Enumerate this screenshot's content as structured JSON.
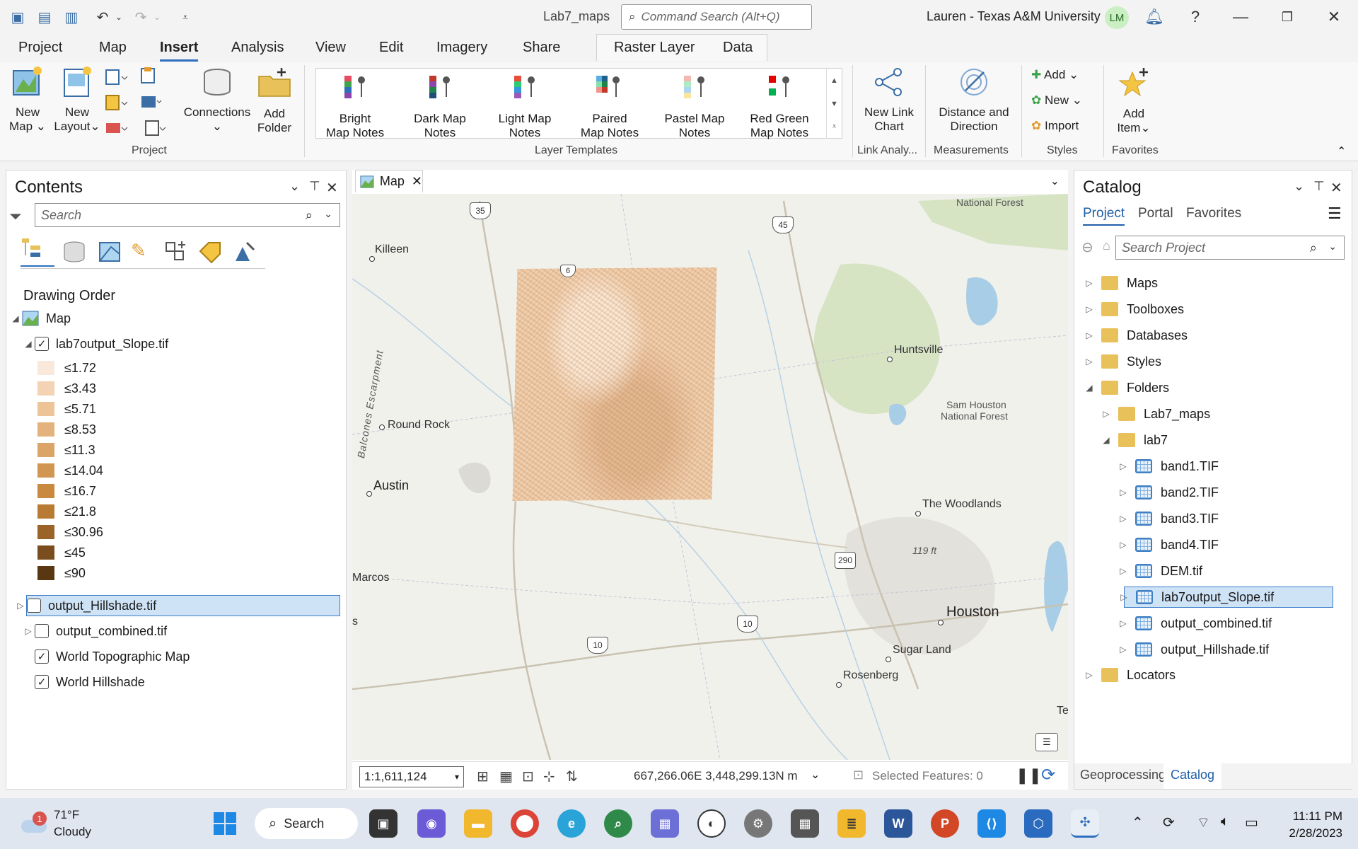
{
  "titlebar": {
    "app_title": "Lab7_maps",
    "command_search_placeholder": "Command Search (Alt+Q)",
    "user": "Lauren - Texas A&M University",
    "avatar_initials": "LM"
  },
  "ribbon_tabs": [
    "Project",
    "Map",
    "Insert",
    "Analysis",
    "View",
    "Edit",
    "Imagery",
    "Share"
  ],
  "active_tab": "Insert",
  "contextual_tabs": [
    "Raster Layer",
    "Data"
  ],
  "ribbon": {
    "project_group": {
      "label": "Project",
      "new_map": [
        "New",
        "Map"
      ],
      "new_layout": [
        "New",
        "Layout"
      ],
      "connections": "Connections",
      "add_folder": [
        "Add",
        "Folder"
      ]
    },
    "layer_templates": {
      "label": "Layer Templates",
      "items": [
        {
          "line1": "Bright",
          "line2": "Map Notes"
        },
        {
          "line1": "Dark Map",
          "line2": "Notes"
        },
        {
          "line1": "Light Map",
          "line2": "Notes"
        },
        {
          "line1": "Paired",
          "line2": "Map Notes"
        },
        {
          "line1": "Pastel Map",
          "line2": "Notes"
        },
        {
          "line1": "Red Green",
          "line2": "Map Notes"
        }
      ]
    },
    "link_analysis": {
      "label": "Link Analy...",
      "button": [
        "New Link",
        "Chart"
      ]
    },
    "measurements": {
      "label": "Measurements",
      "button": [
        "Distance and",
        "Direction"
      ]
    },
    "styles": {
      "label": "Styles",
      "add": "Add",
      "new": "New",
      "import": "Import"
    },
    "favorites": {
      "label": "Favorites",
      "button": [
        "Add",
        "Item"
      ]
    }
  },
  "contents": {
    "title": "Contents",
    "search_placeholder": "Search",
    "section": "Drawing Order",
    "map_node": "Map",
    "slope_layer": "lab7output_Slope.tif",
    "legend": [
      {
        "label": "≤1.72",
        "color": "#fbe8dc"
      },
      {
        "label": "≤3.43",
        "color": "#f3d3b3"
      },
      {
        "label": "≤5.71",
        "color": "#ecc498"
      },
      {
        "label": "≤8.53",
        "color": "#e3b27d"
      },
      {
        "label": "≤11.3",
        "color": "#dba567"
      },
      {
        "label": "≤14.04",
        "color": "#d19651"
      },
      {
        "label": "≤16.7",
        "color": "#c98a3f"
      },
      {
        "label": "≤21.8",
        "color": "#b97a33"
      },
      {
        "label": "≤30.96",
        "color": "#9a6428"
      },
      {
        "label": "≤45",
        "color": "#7a4d1e"
      },
      {
        "label": "≤90",
        "color": "#5a3713"
      }
    ],
    "other_layers": [
      {
        "name": "output_Hillshade.tif",
        "checked": false,
        "selected": true
      },
      {
        "name": "output_combined.tif",
        "checked": false,
        "selected": false
      },
      {
        "name": "World Topographic Map",
        "checked": true,
        "selected": false
      },
      {
        "name": "World Hillshade",
        "checked": true,
        "selected": false
      }
    ]
  },
  "map": {
    "tab": "Map",
    "labels": {
      "killeen": "Killeen",
      "round_rock": "Round Rock",
      "austin": "Austin",
      "marcos": "Marcos",
      "s": "s",
      "balcones": "Balcones Escarpment",
      "national_forest": "National Forest",
      "huntsville": "Huntsville",
      "sam_houston": "Sam Houston",
      "sam_houston2": "National Forest",
      "woodlands": "The Woodlands",
      "elev": "119 ft",
      "houston": "Houston",
      "sugar_land": "Sugar Land",
      "rosenberg": "Rosenberg",
      "te": "Te"
    },
    "shields": [
      "35",
      "45",
      "6",
      "290",
      "10",
      "10"
    ],
    "scale": "1:1,611,124",
    "coordinates": "667,266.06E 3,448,299.13N m",
    "selected_features": "Selected Features: 0"
  },
  "catalog": {
    "title": "Catalog",
    "tabs": [
      "Project",
      "Portal",
      "Favorites"
    ],
    "search_placeholder": "Search Project",
    "top_items": [
      "Maps",
      "Toolboxes",
      "Databases",
      "Styles",
      "Folders"
    ],
    "folders": [
      "Lab7_maps",
      "lab7"
    ],
    "files": [
      "band1.TIF",
      "band2.TIF",
      "band3.TIF",
      "band4.TIF",
      "DEM.tif",
      "lab7output_Slope.tif",
      "output_combined.tif",
      "output_Hillshade.tif"
    ],
    "locators": "Locators",
    "bottom_tabs": [
      "Geoprocessing",
      "Catalog"
    ]
  },
  "taskbar": {
    "weather_temp": "71°F",
    "weather_desc": "Cloudy",
    "weather_badge": "1",
    "search": "Search",
    "time": "11:11 PM",
    "date": "2/28/2023"
  }
}
